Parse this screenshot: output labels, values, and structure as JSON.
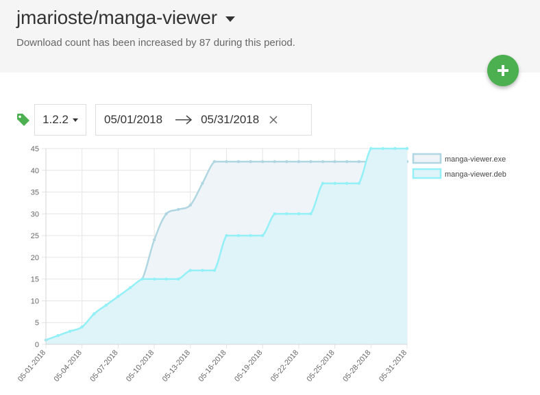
{
  "header": {
    "title": "jmarioste/manga-viewer",
    "subtitle": "Download count has been increased by 87 during this period."
  },
  "controls": {
    "version": "1.2.2",
    "date_from": "05/01/2018",
    "date_to": "05/31/2018"
  },
  "icons": {
    "tag": "tag-icon",
    "add": "plus-icon",
    "clear": "close-icon",
    "arrow": "arrow-right-icon"
  },
  "colors": {
    "fab": "#4caf50",
    "tag": "#4caf50",
    "exe_line": "#b0d6e2",
    "exe_fill": "#eef4f8",
    "deb_line": "#94f0f7",
    "deb_fill": "#dff4f9"
  },
  "chart_data": {
    "type": "area",
    "x": [
      "05-01-2018",
      "05-02-2018",
      "05-03-2018",
      "05-04-2018",
      "05-05-2018",
      "05-06-2018",
      "05-07-2018",
      "05-08-2018",
      "05-09-2018",
      "05-10-2018",
      "05-11-2018",
      "05-12-2018",
      "05-13-2018",
      "05-14-2018",
      "05-15-2018",
      "05-16-2018",
      "05-17-2018",
      "05-18-2018",
      "05-19-2018",
      "05-20-2018",
      "05-21-2018",
      "05-22-2018",
      "05-23-2018",
      "05-24-2018",
      "05-25-2018",
      "05-26-2018",
      "05-27-2018",
      "05-28-2018",
      "05-29-2018",
      "05-30-2018",
      "05-31-2018"
    ],
    "x_tick_labels": [
      "05-01-2018",
      "05-04-2018",
      "05-07-2018",
      "05-10-2018",
      "05-13-2018",
      "05-16-2018",
      "05-19-2018",
      "05-22-2018",
      "05-25-2018",
      "05-28-2018",
      "05-31-2018"
    ],
    "series": [
      {
        "name": "manga-viewer.exe",
        "values": [
          1,
          2,
          3,
          4,
          7,
          9,
          11,
          13,
          15,
          24,
          30,
          31,
          32,
          37,
          42,
          42,
          42,
          42,
          42,
          42,
          42,
          42,
          42,
          42,
          42,
          42,
          42,
          42,
          42,
          42,
          42
        ]
      },
      {
        "name": "manga-viewer.deb",
        "values": [
          1,
          2,
          3,
          4,
          7,
          9,
          11,
          13,
          15,
          15,
          15,
          15,
          17,
          17,
          17,
          25,
          25,
          25,
          25,
          30,
          30,
          30,
          30,
          37,
          37,
          37,
          37,
          45,
          45,
          45,
          45
        ]
      }
    ],
    "ylim": [
      0,
      45
    ],
    "y_ticks": [
      0,
      5,
      10,
      15,
      20,
      25,
      30,
      35,
      40,
      45
    ],
    "grid": true,
    "legend_position": "top-right"
  }
}
